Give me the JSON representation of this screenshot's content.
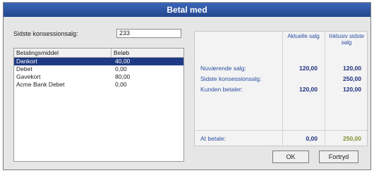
{
  "dialog": {
    "title": "Betal med"
  },
  "left": {
    "field_label": "Sidste konsessionsalg:",
    "field_value": "233",
    "table": {
      "headers": [
        "Betalingsmiddel",
        "Beløb"
      ],
      "rows": [
        [
          "Dankort",
          "40,00"
        ],
        [
          "Debet",
          "0,00"
        ],
        [
          "Gavekort",
          "80,00"
        ],
        [
          "Acme Bank Debet",
          "0,00"
        ]
      ],
      "selected_index": 0
    }
  },
  "right": {
    "col_current": "Aktuelle salg",
    "col_including": "Inklusiv sidste salg",
    "rows": [
      {
        "label": "Nuværende salg:",
        "current": "120,00",
        "including": "120,00"
      },
      {
        "label": "Sidste konsessionsalg:",
        "current": "",
        "including": "250,00"
      },
      {
        "label": "Kunden betaler:",
        "current": "120,00",
        "including": "120,00"
      }
    ],
    "footer": {
      "label": "At betale:",
      "current": "0,00",
      "including": "250,00"
    }
  },
  "buttons": {
    "ok": "OK",
    "cancel": "Fortryd"
  },
  "colors": {
    "title_bar": "#24478f",
    "selection": "#1f3a84",
    "value_blue": "#1b2f7e",
    "value_green": "#7f8e2c"
  }
}
